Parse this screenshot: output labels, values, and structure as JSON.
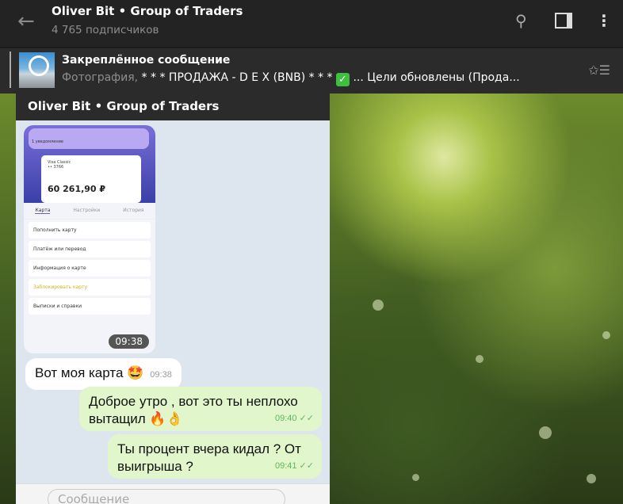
{
  "header": {
    "title": "Oliver Bit • Group of Traders",
    "subtitle": "4 765 подписчиков",
    "icons": [
      "back-arrow-icon",
      "search-icon",
      "sidebar-toggle-icon",
      "more-vertical-icon"
    ]
  },
  "pinned": {
    "title": "Закреплённое сообщение",
    "prefix": "Фотография,",
    "text": " * * *  ПРОДАЖА - D E X (BNB)  * * * ",
    "check": "✓",
    "suffix": " ... Цели обновлены (Прода..."
  },
  "photo": {
    "chat_title": "Oliver Bit • Group of Traders",
    "bank": {
      "notification": "1 уведомление",
      "card_name": "Visa Classic",
      "card_num": "•• 3766",
      "brand": "VISA",
      "balance": "60 261,90 ₽",
      "tabs": [
        "Карта",
        "Настройки",
        "История"
      ],
      "rows": [
        "Пополнить карту",
        "Платёж или перевод",
        "Информация о карте",
        "Заблокировать карту",
        "Выписки и справки"
      ],
      "time": "09:38"
    },
    "messages": [
      {
        "dir": "in",
        "text": "Вот моя карта 🤩",
        "time": "09:38"
      },
      {
        "dir": "out",
        "text": "Доброе утро , вот это ты неплохо вытащил 🔥👌",
        "time": "09:40 ✓✓"
      },
      {
        "dir": "out",
        "text": "Ты процент вчера кидал ? От выигрыша ?",
        "time": "09:41 ✓✓"
      }
    ],
    "input_placeholder": "Сообщение"
  }
}
